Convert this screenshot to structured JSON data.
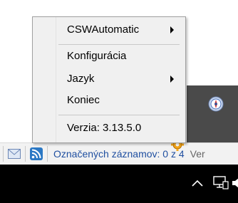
{
  "menu": {
    "items": [
      {
        "label": "CSWAutomatic",
        "submenu": true
      },
      {
        "label": "Konfigurácia",
        "submenu": false,
        "highlighted": true
      },
      {
        "label": "Jazyk",
        "submenu": true
      },
      {
        "label": "Koniec",
        "submenu": false
      },
      {
        "label": "Verzia: 3.13.5.0",
        "submenu": false
      }
    ]
  },
  "statusbar": {
    "status_text": "Označených záznamov: 0 z 4",
    "trailing_text": "Ver"
  },
  "colors": {
    "highlight": "#fff200",
    "link_text": "#1f4fa0",
    "taskbar": "#000000",
    "dark_panel": "#4a4a4a"
  },
  "icons": {
    "mail": "mail-icon",
    "rss": "rss-feed-icon",
    "navigation": "navigation-compass-icon",
    "gear": "gear-icon",
    "tray_chevron": "chevron-up-icon",
    "tray_network": "network-icon",
    "tray_volume": "volume-icon"
  }
}
